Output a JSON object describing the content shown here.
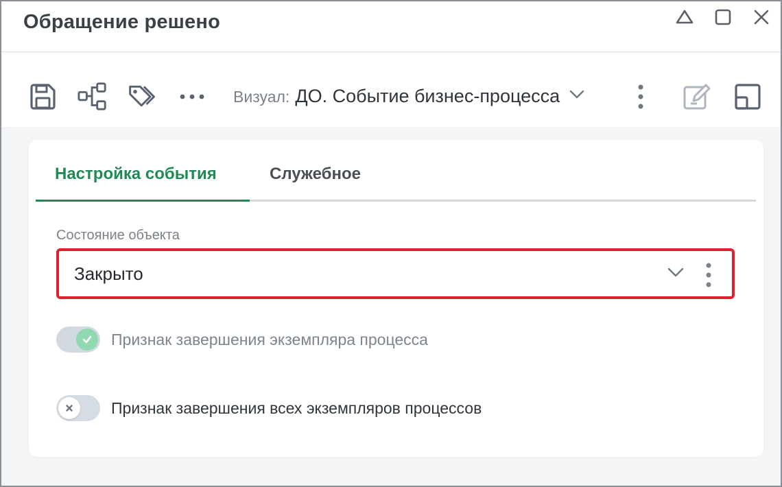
{
  "window": {
    "title": "Обращение решено",
    "controls": [
      "collapse-icon",
      "maximize-icon",
      "close-icon"
    ]
  },
  "toolbar": {
    "icons": [
      "save-icon",
      "diagram-icon",
      "tag-icon",
      "more-horizontal-icon"
    ],
    "vizual_label": "Визуал:",
    "vizual_value": "ДО. Событие бизнес-процесса",
    "right_icons": [
      "edit-icon",
      "layout-icon"
    ]
  },
  "tabs": [
    {
      "label": "Настройка события",
      "active": true
    },
    {
      "label": "Служебное",
      "active": false
    }
  ],
  "form": {
    "state_field": {
      "label": "Состояние объекта",
      "value": "Закрыто",
      "highlighted": true
    },
    "toggles": [
      {
        "label": "Признак завершения экземпляра процесса",
        "checked": true,
        "disabled": true
      },
      {
        "label": "Признак завершения всех экземпляров процессов",
        "checked": false,
        "disabled": false
      }
    ]
  },
  "colors": {
    "accent": "#1f8a55",
    "highlight_border": "#e0202f",
    "toggle_on_knob": "#8fd9b1",
    "toggle_off_track": "#d6dce3"
  }
}
